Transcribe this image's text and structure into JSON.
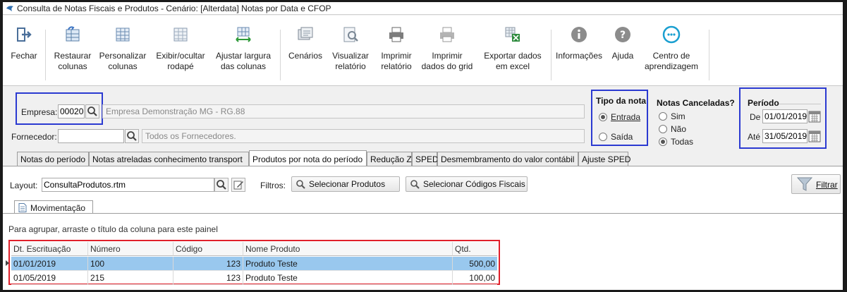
{
  "window": {
    "title": "Consulta de Notas Fiscais e Produtos - Cenário: [Alterdata] Notas por Data e CFOP"
  },
  "ribbon": {
    "buttons": [
      {
        "label1": "Fechar",
        "label2": "",
        "icon": "exit-icon"
      },
      {
        "label1": "Restaurar",
        "label2": "colunas",
        "icon": "restore-columns-icon"
      },
      {
        "label1": "Personalizar",
        "label2": "colunas",
        "icon": "customize-columns-icon"
      },
      {
        "label1": "Exibir/ocultar",
        "label2": "rodapé",
        "icon": "footer-toggle-icon"
      },
      {
        "label1": "Ajustar largura",
        "label2": "das colunas",
        "icon": "column-width-icon"
      },
      {
        "label1": "Cenários",
        "label2": "",
        "icon": "scenarios-icon"
      },
      {
        "label1": "Visualizar",
        "label2": "relatório",
        "icon": "preview-report-icon"
      },
      {
        "label1": "Imprimir",
        "label2": "relatório",
        "icon": "print-report-icon"
      },
      {
        "label1": "Imprimir",
        "label2": "dados do grid",
        "icon": "print-grid-icon"
      },
      {
        "label1": "Exportar dados",
        "label2": "em excel",
        "icon": "export-excel-icon"
      },
      {
        "label1": "Informações",
        "label2": "",
        "icon": "info-icon"
      },
      {
        "label1": "Ajuda",
        "label2": "",
        "icon": "help-icon"
      },
      {
        "label1": "Centro de",
        "label2": "aprendizagem",
        "icon": "learning-center-icon"
      }
    ]
  },
  "filters": {
    "empresa_label": "Empresa:",
    "empresa_code": "00020",
    "empresa_name": "Empresa Demonstração MG - RG.88",
    "fornecedor_label": "Fornecedor:",
    "fornecedor_code": "",
    "fornecedor_name": "Todos os Fornecedores."
  },
  "tipo_nota": {
    "title": "Tipo da nota",
    "options": [
      "Entrada",
      "Saída"
    ],
    "selected": "Entrada"
  },
  "canceladas": {
    "title": "Notas Canceladas?",
    "options": [
      "Sim",
      "Não",
      "Todas"
    ],
    "selected": "Todas"
  },
  "periodo": {
    "title": "Período",
    "de_label": "De",
    "de": "01/01/2019",
    "ate_label": "Até",
    "ate": "31/05/2019"
  },
  "tabs": [
    "Notas do período",
    "Notas atreladas conhecimento transport",
    "Produtos por nota do período",
    "Redução Z",
    "SPED",
    "Desmembramento do valor contábil",
    "Ajuste SPED"
  ],
  "active_tab": "Produtos por nota do período",
  "layout_bar": {
    "layout_label": "Layout:",
    "layout_value": "ConsultaProdutos.rtm",
    "filtros_label": "Filtros:",
    "select_products": "Selecionar Produtos",
    "select_fiscal_codes": "Selecionar Códigos Fiscais",
    "filter_button": "Filtrar"
  },
  "subtab": "Movimentação",
  "group_hint": "Para agrupar, arraste o título da coluna para este painel",
  "grid": {
    "columns": [
      "Dt. Escrituação",
      "Número",
      "Código",
      "Nome Produto",
      "Qtd."
    ],
    "rows": [
      [
        "01/01/2019",
        "100",
        "123",
        "Produto Teste",
        "500,00"
      ],
      [
        "01/05/2019",
        "215",
        "123",
        "Produto Teste",
        "100,00"
      ]
    ]
  },
  "colors": {
    "highlight_blue": "#2b3ad1",
    "highlight_red": "#e0202a",
    "selected_row": "#99c8ee"
  }
}
